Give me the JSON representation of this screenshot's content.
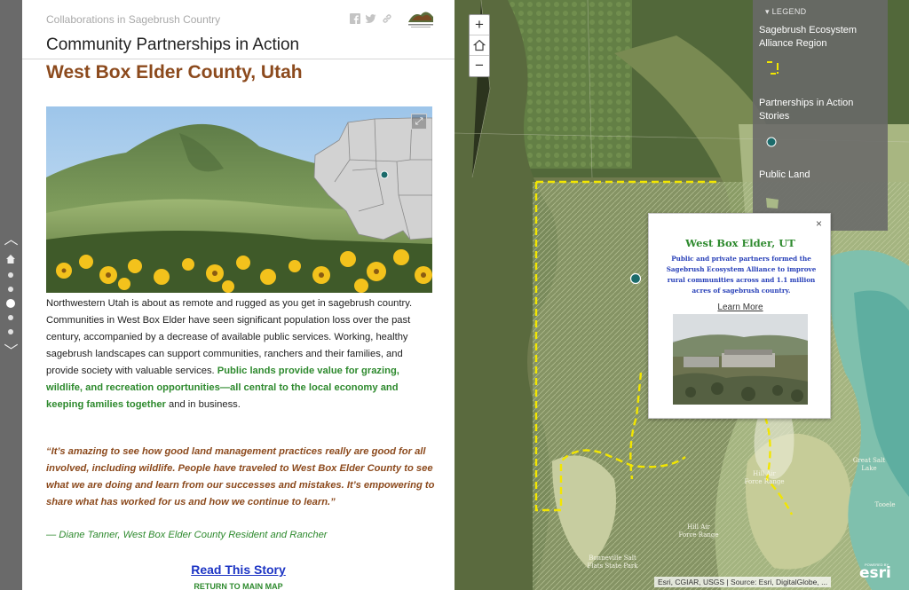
{
  "story": {
    "series_title": "Collaborations in Sagebrush Country",
    "page_title": "Community Partnerships in Action",
    "heading": "West Box Elder County, Utah",
    "body_plain": "Northwestern Utah is about as remote and rugged as you get in sagebrush country. Communities in West Box Elder have seen significant population loss over the past century, accompanied by a decrease of available public services. Working, healthy sagebrush landscapes can support communities, ranchers and their families, and provide society with valuable services.",
    "body_highlight": "Public lands provide value for grazing, wildlife, and recreation opportunities—all central to the local economy and keeping families together",
    "body_end": " and in business.",
    "quote": "“It’s amazing to see how good land management practices really are good for all involved, including wildlife. People have traveled to West Box Elder County to see what we are doing and learn from our successes and mistakes. It’s empowering to share what has worked for us and how we continue to learn.”",
    "attribution": "— Diane Tanner, West Box Elder County Resident and Rancher",
    "read_link": "Read This Story",
    "return_link": "RETURN TO MAIN MAP"
  },
  "share_icons": [
    "facebook-icon",
    "twitter-icon",
    "link-icon"
  ],
  "nav": {
    "up_icon": "chevron-up-icon",
    "down_icon": "chevron-down-icon",
    "home_icon": "home-icon",
    "dot_count": 6,
    "active_dot": 3
  },
  "map": {
    "zoom_in": "+",
    "zoom_out": "−",
    "legend": {
      "header": "LEGEND",
      "items": [
        {
          "label": "Sagebrush Ecosystem Alliance Region"
        },
        {
          "label": "Partnerships in Action Stories"
        },
        {
          "label": "Public Land"
        }
      ]
    },
    "popup": {
      "close": "×",
      "title": "West Box Elder, UT",
      "description": "Public and private partners formed the Sagebrush Ecosystem Alliance to improve rural communities across and 1.1 million acres of sagebrush country.",
      "link": "Learn More"
    },
    "labels": {
      "great_salt_lake": "Great Salt Lake",
      "hill_afb_1": "Hill Air Force Range",
      "hill_afb_2": "Hill Air Force Range",
      "bonneville": "Bonneville Salt Flats State Park",
      "tooele": "Tooele"
    },
    "attribution": "Esri, CGIAR, USGS | Source: Esri, DigitalGlobe, ...",
    "esri_logo": "esri",
    "powered_by": "POWERED BY"
  },
  "colors": {
    "heading": "#8c4a1d",
    "highlight": "#2e8a2e",
    "link": "#1c34c4",
    "marker": "#1b6b6b",
    "alliance_boundary": "#f2e600"
  }
}
